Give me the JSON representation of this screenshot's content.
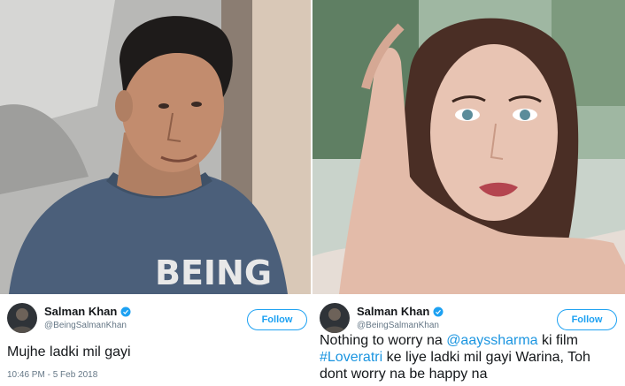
{
  "left_tweet": {
    "name": "Salman Khan",
    "handle": "@BeingSalmanKhan",
    "follow_label": "Follow",
    "text": "Mujhe ladki mil gayi",
    "timestamp": "10:46 PM - 5 Feb 2018"
  },
  "right_tweet": {
    "name": "Salman Khan",
    "handle": "@BeingSalmanKhan",
    "follow_label": "Follow",
    "text_1": "Nothing to worry na ",
    "mention": "@aayssharma",
    "text_2": " ki film ",
    "hashtag": "#Loveratri",
    "text_3": " ke liye ladki mil gayi Warina, Toh dont worry na be happy na"
  },
  "photo_left": {
    "shirt_text": "BEING"
  },
  "colors": {
    "link": "#1b95e0",
    "follow": "#1da1f2",
    "verified": "#1da1f2"
  },
  "icons": [
    "verified-badge-icon",
    "avatar"
  ]
}
